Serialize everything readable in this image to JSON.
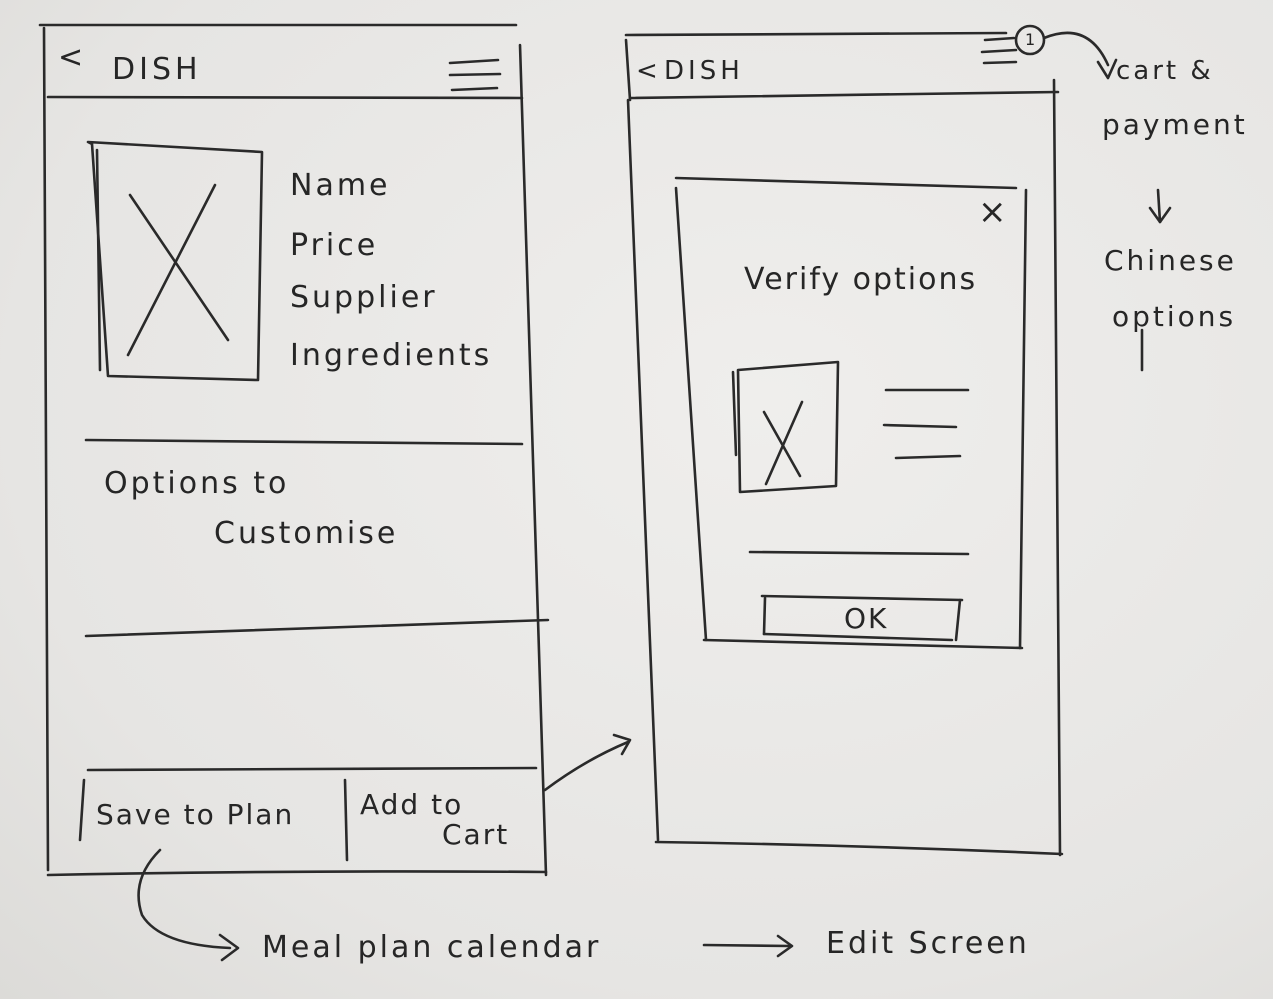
{
  "screen1": {
    "back_glyph": "<",
    "title": "DISH",
    "fields": [
      "Name",
      "Price",
      "Supplier",
      "Ingredients"
    ],
    "options_line1": "Options to",
    "options_line2": "Customise",
    "save_button": "Save to Plan",
    "add_line1": "Add to",
    "add_line2": "Cart"
  },
  "screen2": {
    "back_glyph": "<",
    "title": "DISH",
    "badge": "1",
    "close": "×",
    "dialog_title": "Verify options",
    "ok_button": "OK"
  },
  "annotations": {
    "right_line1": "cart &",
    "right_line2": "payment",
    "right_line3": "Chinese",
    "right_line4": "options",
    "bottom_left": "Meal plan calendar",
    "bottom_right": "Edit Screen"
  },
  "ink_color": "#2a2a2a"
}
